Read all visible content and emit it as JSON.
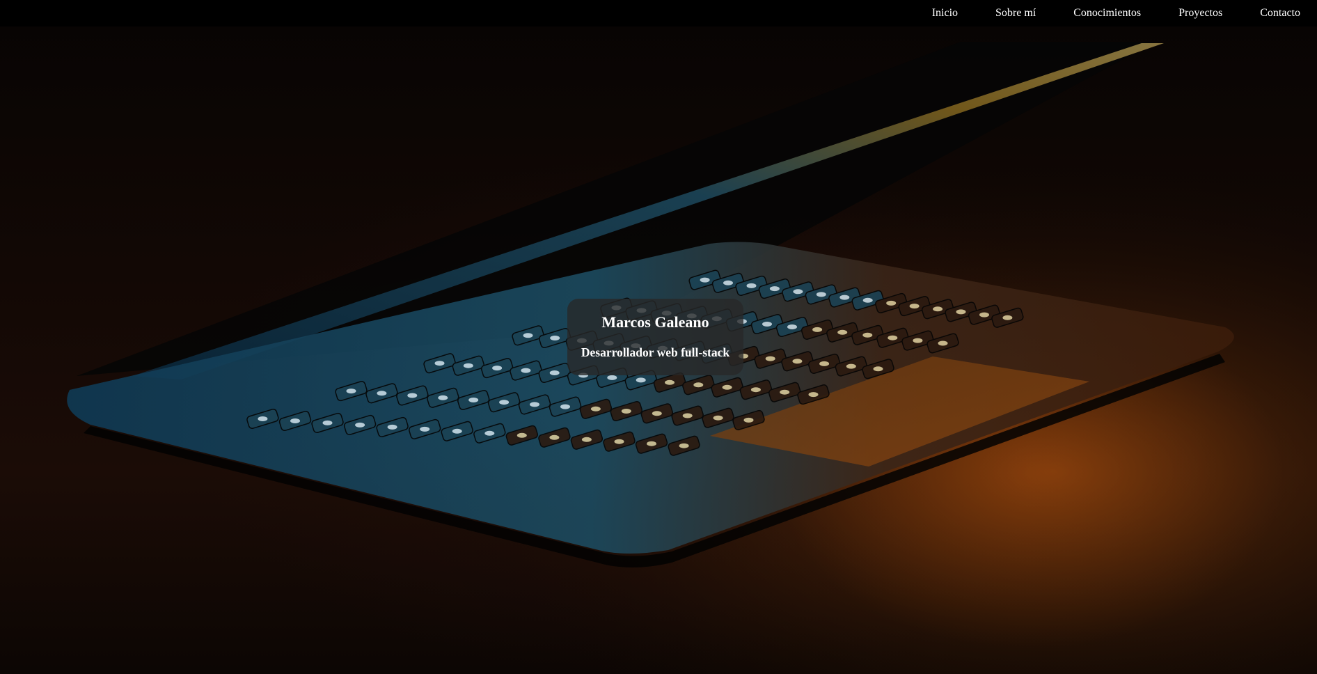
{
  "nav": {
    "items": [
      {
        "label": "Inicio"
      },
      {
        "label": "Sobre mí"
      },
      {
        "label": "Conocimientos"
      },
      {
        "label": "Proyectos"
      },
      {
        "label": "Contacto"
      }
    ]
  },
  "hero": {
    "name": "Marcos Galeano",
    "subtitle": "Desarrollador web full-stack",
    "background_image": "backlit-laptop-keyboard-photo"
  },
  "colors": {
    "navbar": "#000000",
    "nav_text": "#ffffff",
    "card_background": "#282828",
    "keyboard_glow": "#6fb8d8",
    "orange_glow": "#d7680f"
  }
}
